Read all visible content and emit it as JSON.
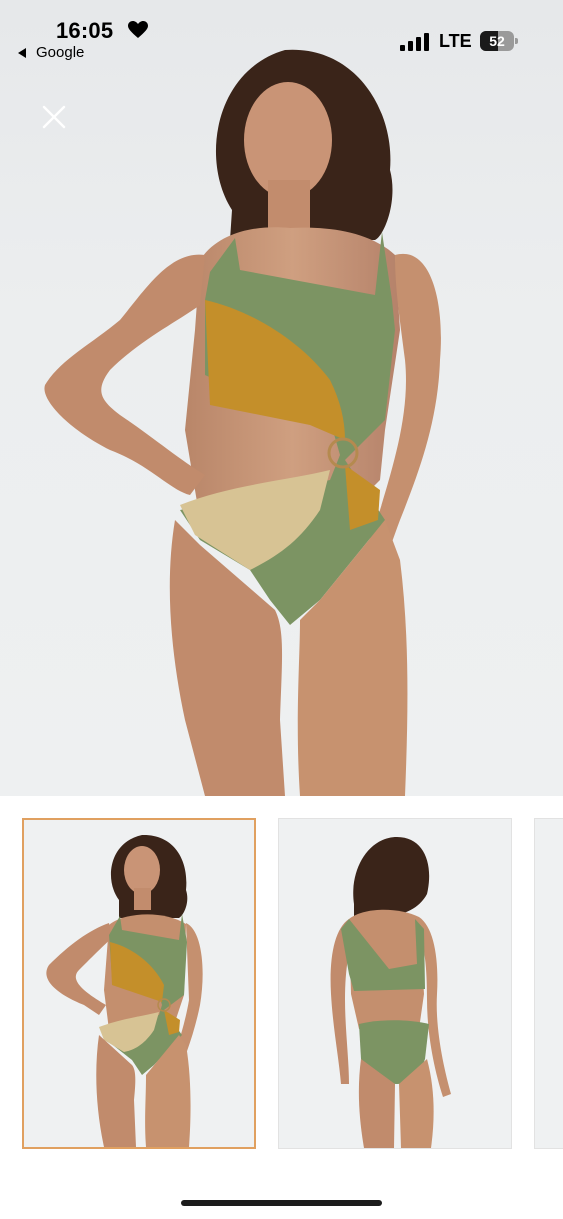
{
  "status_bar": {
    "time": "16:05",
    "back_label": "Google",
    "network": "LTE",
    "battery_level": "52",
    "icons": [
      "heart-icon",
      "signal-icon",
      "battery-icon"
    ]
  },
  "viewer": {
    "close_icon": "close-icon",
    "selected_thumbnail_index": 0,
    "thumbnail_count_visible": 3
  },
  "colors": {
    "selected_border": "#e0a060",
    "swimsuit_green": "#7c9463",
    "swimsuit_mustard": "#c48f2a",
    "swimsuit_beige": "#d7c394"
  }
}
